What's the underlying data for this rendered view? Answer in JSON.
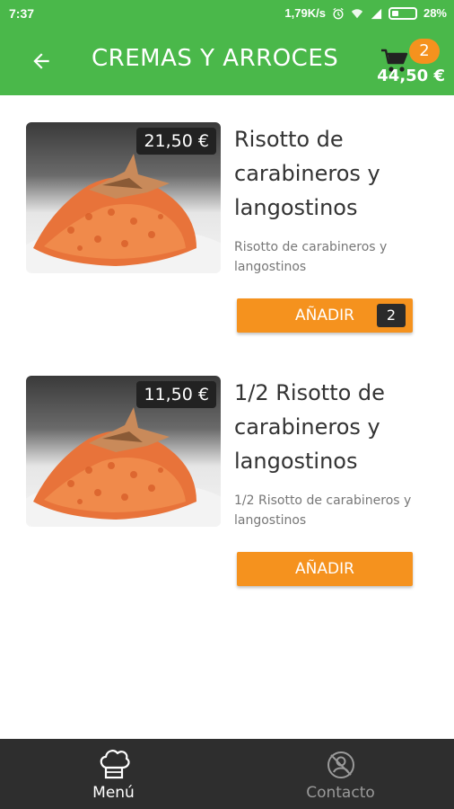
{
  "status_bar": {
    "time": "7:37",
    "network_speed": "1,79K/s",
    "battery": "28%",
    "icons": [
      "alarm-icon",
      "wifi-icon",
      "signal-icon",
      "battery-icon"
    ]
  },
  "app_bar": {
    "title": "CREMAS Y ARROCES",
    "cart_count": "2",
    "cart_total": "44,50 €",
    "colors": {
      "primary": "#4ab84a",
      "accent": "#f5921e"
    }
  },
  "products": [
    {
      "price": "21,50 €",
      "name": "Risotto de carabineros y langostinos",
      "description": "Risotto de carabineros y langostinos",
      "add_label": "AÑADIR",
      "quantity": "2"
    },
    {
      "price": "11,50 €",
      "name": "1/2 Risotto de carabineros y langostinos",
      "description": "1/2 Risotto de carabineros y langostinos",
      "add_label": "AÑADIR"
    }
  ],
  "bottom_nav": {
    "items": [
      {
        "label": "Menú",
        "icon": "chef-hat-icon",
        "active": true
      },
      {
        "label": "Contacto",
        "icon": "contact-icon",
        "active": false
      }
    ]
  }
}
